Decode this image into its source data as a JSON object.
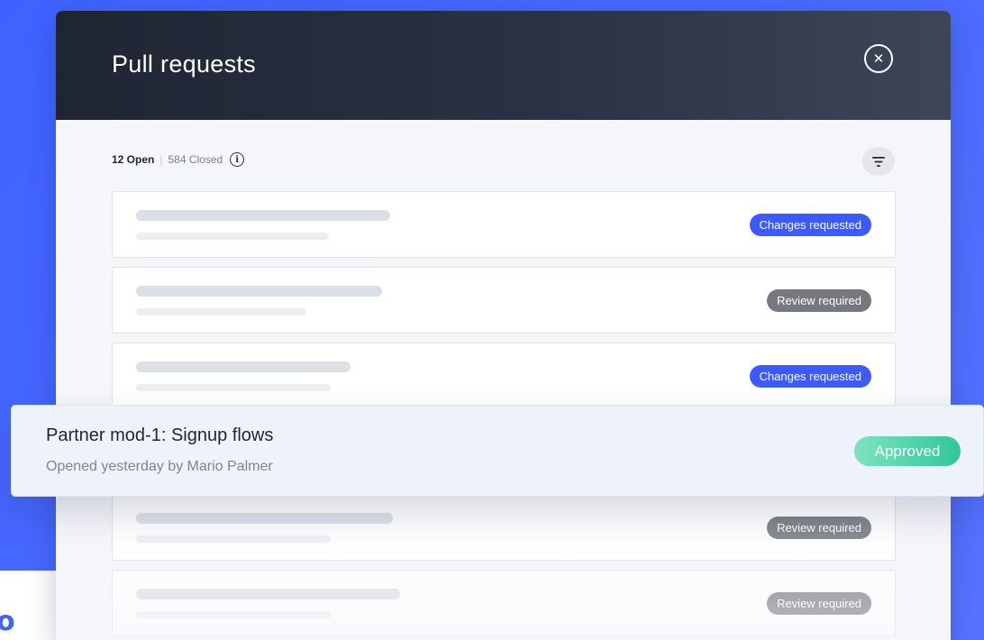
{
  "panel": {
    "title": "Pull requests",
    "close_icon": "close-icon"
  },
  "counts": {
    "open": "12 Open",
    "separator": "|",
    "closed": "584 Closed",
    "info_icon": "info-icon"
  },
  "filter": {
    "icon": "filter-icon"
  },
  "rows": [
    {
      "badge": "Changes requested",
      "status": "changes"
    },
    {
      "badge": "Review required",
      "status": "review"
    },
    {
      "badge": "Changes requested",
      "status": "changes"
    },
    {
      "badge": "Review required",
      "status": "review"
    },
    {
      "badge": "Review required",
      "status": "review"
    }
  ],
  "featured": {
    "title": "Partner mod-1: Signup flows",
    "subtitle": "Opened yesterday by Mario Palmer",
    "badge": "Approved"
  },
  "colors": {
    "background": "#4262ff",
    "header": "#1f2533",
    "changes_badge": "#3d5afe",
    "review_badge": "#75787f",
    "approved_badge": "#2fc79a"
  }
}
